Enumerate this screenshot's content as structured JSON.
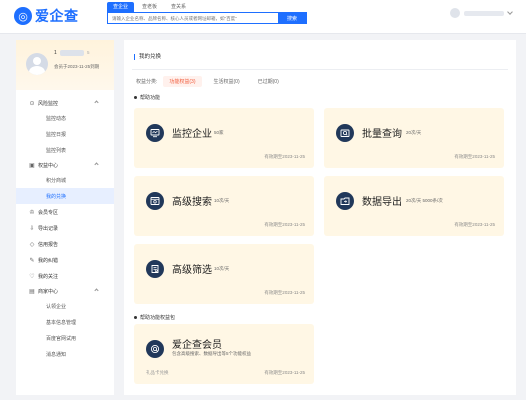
{
  "header": {
    "logo_text": "爱企查",
    "search_tabs": [
      "查企业",
      "查老板",
      "查关系"
    ],
    "search_placeholder": "请输入企业名称、品牌名称、核心人员或者网址邮箱，如\"百度\"",
    "search_button": "搜索"
  },
  "profile": {
    "name_prefix": "1",
    "level_suffix": "5",
    "expiry": "会员于2023-11-25到期"
  },
  "sidebar": {
    "groups": [
      {
        "label": "风险监控",
        "icon": "shield-icon",
        "items": [
          "监控动态",
          "监控日报",
          "监控列表"
        ]
      },
      {
        "label": "权益中心",
        "icon": "gift-icon",
        "items": [
          "积分商城",
          "我的兑换"
        ]
      }
    ],
    "active_item": "我的兑换",
    "singles": [
      {
        "label": "会员专区",
        "icon": "crown-icon"
      },
      {
        "label": "导出记录",
        "icon": "download-icon"
      },
      {
        "label": "信用报告",
        "icon": "report-icon"
      },
      {
        "label": "我的纠错",
        "icon": "edit-icon"
      },
      {
        "label": "我的关注",
        "icon": "heart-icon"
      }
    ],
    "merchant_group": {
      "label": "商家中心",
      "icon": "store-icon",
      "items": [
        "认领企业",
        "基本信息管理",
        "百度官网试用",
        "消息通知"
      ]
    }
  },
  "main": {
    "title": "我的兑换",
    "filter_label": "权益分类:",
    "filters": [
      {
        "label": "功能权益(3)",
        "active": true
      },
      {
        "label": "生活权益(0)",
        "active": false
      },
      {
        "label": "已过期(0)",
        "active": false
      }
    ],
    "section_1": "帮助功能",
    "section_2": "帮助功能权益包",
    "cards": [
      {
        "title": "监控企业",
        "quota": "50家",
        "expiry": "有效期至2023-11-25",
        "icon": "monitor-icon"
      },
      {
        "title": "批量查询",
        "quota": "20次/天",
        "expiry": "有效期至2023-11-25",
        "icon": "batch-query-icon"
      },
      {
        "title": "高级搜索",
        "quota": "10次/天",
        "expiry": "有效期至2023-11-25",
        "icon": "advanced-search-icon"
      },
      {
        "title": "数据导出",
        "quota": "20次/天 5000条/次",
        "expiry": "有效期至2023-11-25",
        "icon": "data-export-icon"
      },
      {
        "title": "高级筛选",
        "quota": "10次/天",
        "expiry": "有效期至2023-11-25",
        "icon": "filter-icon"
      }
    ],
    "package": {
      "title": "爱企查会员",
      "description": "包含高级搜索、数据导出等5个功能权益",
      "source": "礼品卡兑换",
      "expiry": "有效期至2023-11-25",
      "icon": "member-badge-icon"
    }
  },
  "colors": {
    "brand_blue": "#1e6fff",
    "card_bg": "#fff7e5",
    "active_filter": "#f15a3a",
    "icon_dark": "#21385a"
  }
}
